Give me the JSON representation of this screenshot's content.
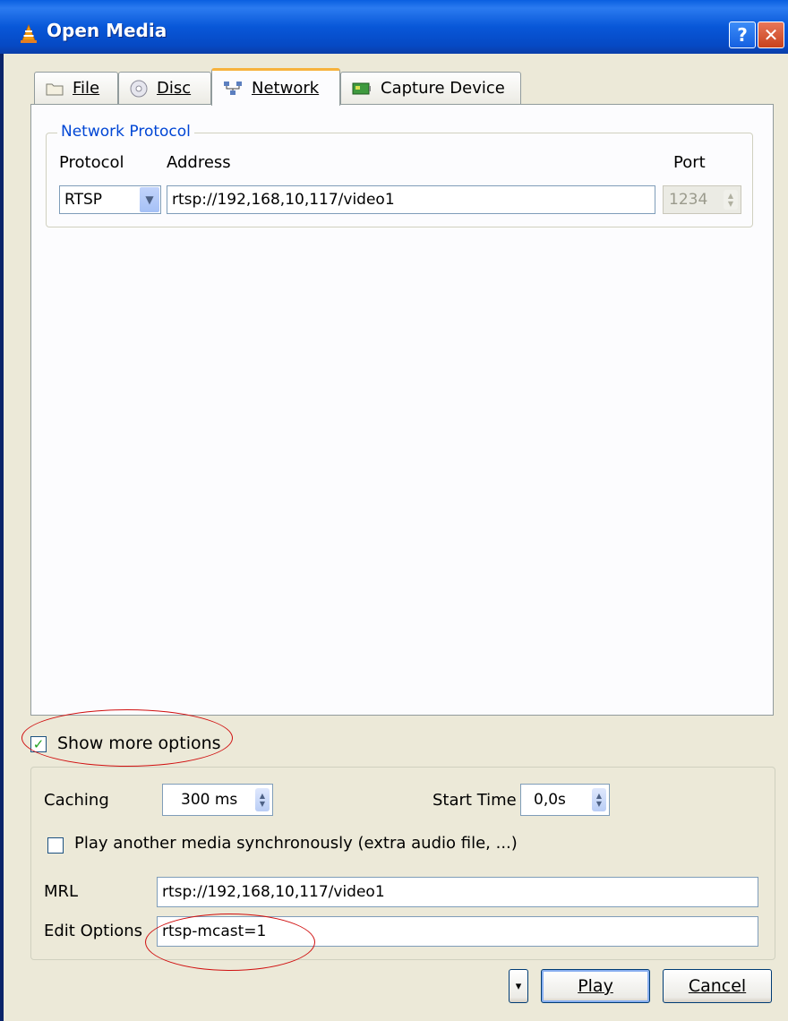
{
  "window": {
    "title": "Open Media",
    "help_glyph": "?",
    "close_glyph": "✕"
  },
  "tabs": [
    {
      "label": "File",
      "icon": "folder-icon"
    },
    {
      "label": "Disc",
      "icon": "disc-icon"
    },
    {
      "label": "Network",
      "icon": "network-icon",
      "active": true
    },
    {
      "label": "Capture Device",
      "icon": "capture-card-icon"
    }
  ],
  "network": {
    "group_title": "Network Protocol",
    "protocol_label": "Protocol",
    "address_label": "Address",
    "port_label": "Port",
    "protocol_value": "RTSP",
    "address_value": "rtsp://192,168,10,117/video1",
    "port_value": "1234"
  },
  "options": {
    "show_more_label": "Show more options",
    "show_more_checked": true,
    "caching_label": "Caching",
    "caching_value": "300 ms",
    "start_time_label": "Start Time",
    "start_time_value": "0,0s",
    "sync_label": "Play another media synchronously (extra audio file, ...)",
    "sync_checked": false,
    "mrl_label": "MRL",
    "mrl_value": "rtsp://192,168,10,117/video1",
    "edit_options_label": "Edit Options",
    "edit_options_value": "rtsp-mcast=1"
  },
  "buttons": {
    "play": "Play",
    "cancel": "Cancel",
    "dropdown_glyph": "▾"
  },
  "colors": {
    "title_bar": "#0a5fe0",
    "group_title": "#0046d5",
    "annotation": "#d01010",
    "active_tab_accent": "#f7b23c"
  }
}
